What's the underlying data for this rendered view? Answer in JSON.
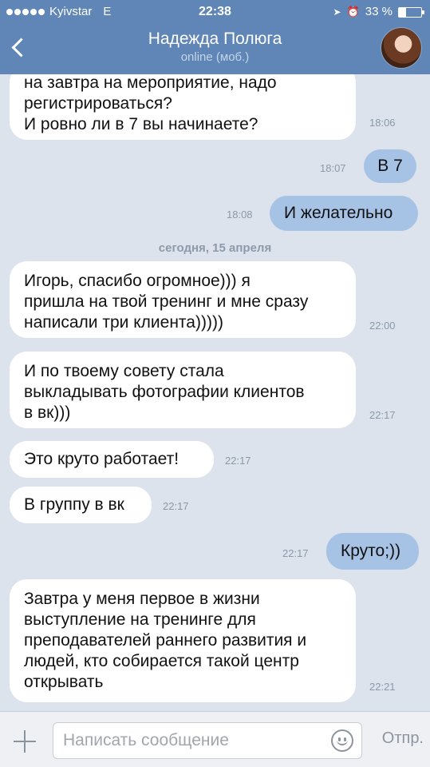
{
  "status_bar": {
    "carrier": "Kyivstar",
    "network": "E",
    "time": "22:38",
    "battery_text": "33 %",
    "battery_level": 0.33
  },
  "header": {
    "contact_name": "Надежда Полюга",
    "presence": "online (моб.)",
    "back_icon": "chevron-left-icon",
    "avatar_icon": "contact-avatar"
  },
  "messages": [
    {
      "dir": "in",
      "lines": [
        "на завтра на мероприятие, надо",
        "регистрироваться?",
        "И ровно ли в 7 вы начинаете?"
      ],
      "time": "18:06"
    },
    {
      "dir": "out",
      "lines": [
        "В 7"
      ],
      "time": "18:07"
    },
    {
      "dir": "out",
      "lines": [
        "И желательно"
      ],
      "time": "18:08"
    },
    {
      "dir": "sep",
      "lines": [
        "сегодня, 15 апреля"
      ]
    },
    {
      "dir": "in",
      "lines": [
        "Игорь, спасибо огромное))) я",
        "пришла на твой тренинг и мне сразу",
        "написали три клиента)))))"
      ],
      "time": "22:00"
    },
    {
      "dir": "in",
      "lines": [
        "И по твоему совету стала",
        "выкладывать фотографии клиентов",
        "в вк)))"
      ],
      "time": "22:17"
    },
    {
      "dir": "in",
      "lines": [
        "Это круто работает!"
      ],
      "time": "22:17"
    },
    {
      "dir": "in",
      "lines": [
        "В группу в вк"
      ],
      "time": "22:17"
    },
    {
      "dir": "out",
      "lines": [
        "Круто;))"
      ],
      "time": "22:17"
    },
    {
      "dir": "in",
      "lines": [
        "Завтра у меня первое в жизни",
        "выступление на тренинге для",
        "преподавателей раннего развития и",
        "людей, кто собирается такой центр",
        "открывать"
      ],
      "time": "22:21"
    }
  ],
  "input_bar": {
    "placeholder": "Написать сообщение",
    "send_label": "Отпр.",
    "attach_icon": "plus-icon",
    "emoji_icon": "smiley-icon"
  },
  "colors": {
    "header_bg": "#5f86b7",
    "chat_bg": "#dce3ec",
    "incoming_bubble": "#ffffff",
    "outgoing_bubble": "#a6c2e4"
  }
}
